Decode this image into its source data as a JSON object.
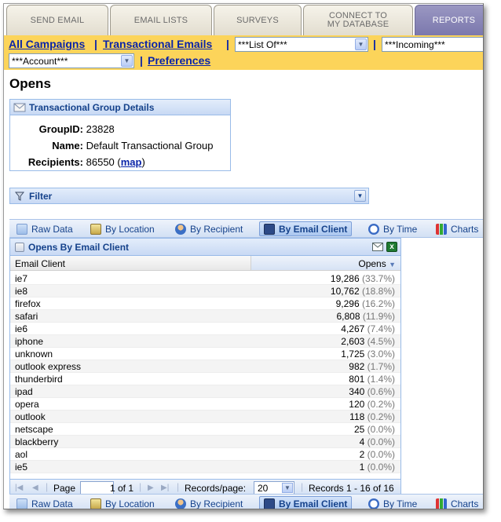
{
  "nav_tabs": [
    {
      "label": "SEND EMAIL"
    },
    {
      "label": "EMAIL LISTS"
    },
    {
      "label": "SURVEYS"
    },
    {
      "label": "CONNECT TO",
      "label2": "MY DATABASE"
    },
    {
      "label": "REPORTS"
    }
  ],
  "campaign_bar": {
    "all_campaigns": "All Campaigns",
    "transactional_emails": "Transactional Emails",
    "list_select": "***List Of***",
    "incoming_select": "***Incoming***",
    "account_select": "***Account***",
    "preferences": "Preferences",
    "separator": "|"
  },
  "page_title": "Opens",
  "group_details": {
    "title": "Transactional Group Details",
    "group_id_label": "GroupID:",
    "group_id": "23828",
    "name_label": "Name:",
    "name": "Default Transactional Group",
    "recipients_label": "Recipients:",
    "recipients": "86550",
    "map_link": "map",
    "paren_open": "(",
    "paren_close": ")"
  },
  "filter": {
    "title": "Filter"
  },
  "report_tabs": [
    {
      "label": "Raw Data"
    },
    {
      "label": "By Location"
    },
    {
      "label": "By Recipient"
    },
    {
      "label": "By Email Client"
    },
    {
      "label": "By Time"
    },
    {
      "label": "Charts"
    }
  ],
  "grid": {
    "title": "Opens By Email Client",
    "col_client": "Email Client",
    "col_opens": "Opens",
    "rows": [
      {
        "client": "ie7",
        "opens": "19,286",
        "pct": "(33.7%)"
      },
      {
        "client": "ie8",
        "opens": "10,762",
        "pct": "(18.8%)"
      },
      {
        "client": "firefox",
        "opens": "9,296",
        "pct": "(16.2%)"
      },
      {
        "client": "safari",
        "opens": "6,808",
        "pct": "(11.9%)"
      },
      {
        "client": "ie6",
        "opens": "4,267",
        "pct": "(7.4%)"
      },
      {
        "client": "iphone",
        "opens": "2,603",
        "pct": "(4.5%)"
      },
      {
        "client": "unknown",
        "opens": "1,725",
        "pct": "(3.0%)"
      },
      {
        "client": "outlook express",
        "opens": "982",
        "pct": "(1.7%)"
      },
      {
        "client": "thunderbird",
        "opens": "801",
        "pct": "(1.4%)"
      },
      {
        "client": "ipad",
        "opens": "340",
        "pct": "(0.6%)"
      },
      {
        "client": "opera",
        "opens": "120",
        "pct": "(0.2%)"
      },
      {
        "client": "outlook",
        "opens": "118",
        "pct": "(0.2%)"
      },
      {
        "client": "netscape",
        "opens": "25",
        "pct": "(0.0%)"
      },
      {
        "client": "blackberry",
        "opens": "4",
        "pct": "(0.0%)"
      },
      {
        "client": "aol",
        "opens": "2",
        "pct": "(0.0%)"
      },
      {
        "client": "ie5",
        "opens": "1",
        "pct": "(0.0%)"
      }
    ]
  },
  "pager": {
    "page_label": "Page",
    "page_value": "1",
    "of_label": "of 1",
    "records_per_page_label": "Records/page:",
    "records_per_page": "20",
    "records_info": "Records 1 - 16 of 16"
  },
  "colors": {
    "yellow_bar": "#fcd45a",
    "link_blue": "#0a24a8",
    "panel_blue": "#15428b",
    "active_tab": "#7b78ad"
  }
}
